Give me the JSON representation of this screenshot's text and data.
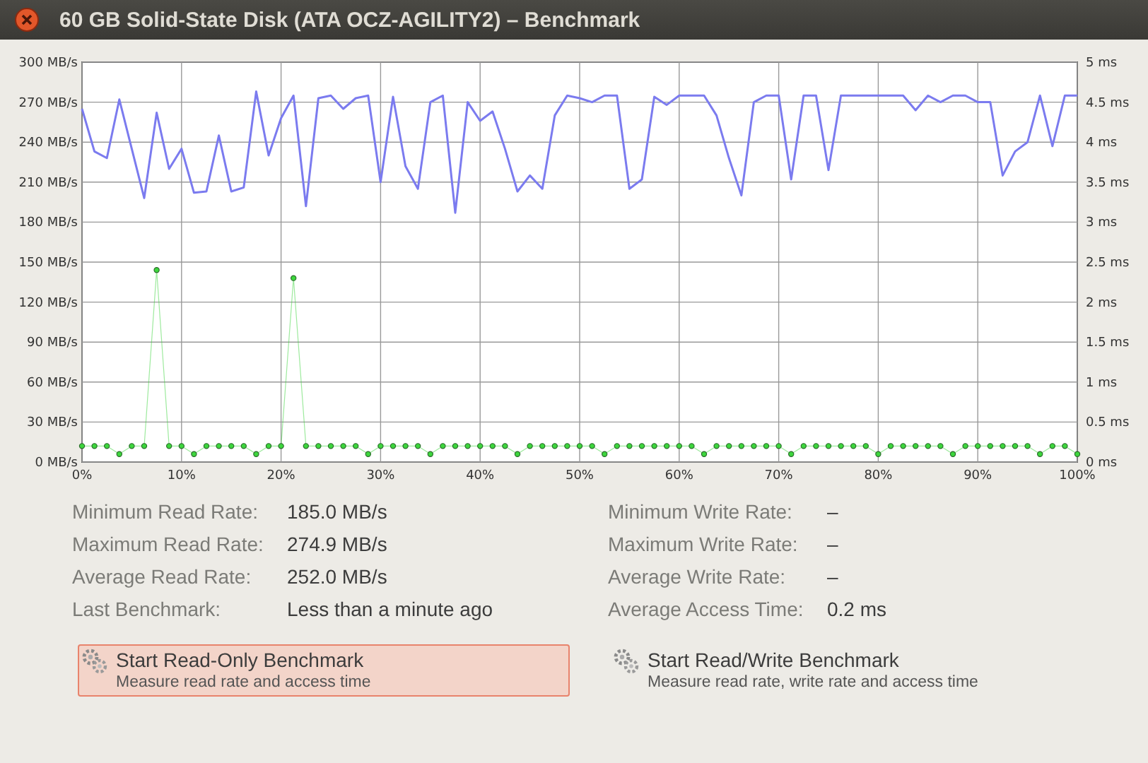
{
  "window": {
    "title": "60 GB Solid-State Disk (ATA OCZ-AGILITY2) – Benchmark"
  },
  "chart": {
    "chart_data": {
      "type": "line",
      "xlim": [
        0,
        100
      ],
      "ylim": [
        0,
        300
      ],
      "grid": true,
      "x": [
        0,
        1.25,
        2.5,
        3.75,
        5,
        6.25,
        7.5,
        8.75,
        10,
        11.25,
        12.5,
        13.75,
        15,
        16.25,
        17.5,
        18.75,
        20,
        21.25,
        22.5,
        23.75,
        25,
        26.25,
        27.5,
        28.75,
        30,
        31.25,
        32.5,
        33.75,
        35,
        36.25,
        37.5,
        38.75,
        40,
        41.25,
        42.5,
        43.75,
        45,
        46.25,
        47.5,
        48.75,
        50,
        51.25,
        52.5,
        53.75,
        55,
        56.25,
        57.5,
        58.75,
        60,
        61.25,
        62.5,
        63.75,
        65,
        66.25,
        67.5,
        68.75,
        70,
        71.25,
        72.5,
        73.75,
        75,
        76.25,
        77.5,
        78.75,
        80,
        81.25,
        82.5,
        83.75,
        85,
        86.25,
        87.5,
        88.75,
        90,
        91.25,
        92.5,
        93.75,
        95,
        96.25,
        97.5,
        98.75,
        100
      ],
      "xticks": [
        {
          "value": 0,
          "label": "0%"
        },
        {
          "value": 10,
          "label": "10%"
        },
        {
          "value": 20,
          "label": "20%"
        },
        {
          "value": 30,
          "label": "30%"
        },
        {
          "value": 40,
          "label": "40%"
        },
        {
          "value": 50,
          "label": "50%"
        },
        {
          "value": 60,
          "label": "60%"
        },
        {
          "value": 70,
          "label": "70%"
        },
        {
          "value": 80,
          "label": "80%"
        },
        {
          "value": 90,
          "label": "90%"
        },
        {
          "value": 100,
          "label": "100%"
        }
      ],
      "yticks": [
        {
          "value": 0,
          "label": "0 MB/s"
        },
        {
          "value": 30,
          "label": "30 MB/s"
        },
        {
          "value": 60,
          "label": "60 MB/s"
        },
        {
          "value": 90,
          "label": "90 MB/s"
        },
        {
          "value": 120,
          "label": "120 MB/s"
        },
        {
          "value": 150,
          "label": "150 MB/s"
        },
        {
          "value": 180,
          "label": "180 MB/s"
        },
        {
          "value": 210,
          "label": "210 MB/s"
        },
        {
          "value": 240,
          "label": "240 MB/s"
        },
        {
          "value": 270,
          "label": "270 MB/s"
        },
        {
          "value": 300,
          "label": "300 MB/s"
        }
      ],
      "y2lim": [
        0,
        5
      ],
      "y2ticks": [
        {
          "value": 0,
          "label": "0 ms"
        },
        {
          "value": 0.5,
          "label": "0.5 ms"
        },
        {
          "value": 1,
          "label": "1 ms"
        },
        {
          "value": 1.5,
          "label": "1.5 ms"
        },
        {
          "value": 2,
          "label": "2 ms"
        },
        {
          "value": 2.5,
          "label": "2.5 ms"
        },
        {
          "value": 3,
          "label": "3 ms"
        },
        {
          "value": 3.5,
          "label": "3.5 ms"
        },
        {
          "value": 4,
          "label": "4 ms"
        },
        {
          "value": 4.5,
          "label": "4.5 ms"
        },
        {
          "value": 5,
          "label": "5 ms"
        }
      ],
      "series": [
        {
          "color": "#7b7bef",
          "values": [
            265,
            233,
            228,
            272,
            235,
            198,
            262,
            220,
            235,
            202,
            203,
            245,
            203,
            206,
            278,
            230,
            258,
            275,
            192,
            273,
            275,
            265,
            273,
            275,
            210,
            274,
            222,
            205,
            270,
            275,
            187,
            270,
            256,
            263,
            235,
            203,
            215,
            205,
            260,
            275,
            273,
            270,
            275,
            275,
            205,
            212,
            274,
            268,
            275,
            275,
            275,
            260,
            228,
            200,
            270,
            275,
            275,
            212,
            275,
            275,
            219,
            275,
            275,
            275,
            275,
            275,
            275,
            264,
            275,
            270,
            275,
            275,
            270,
            270,
            215,
            233,
            240,
            275,
            237,
            275,
            275
          ]
        },
        {
          "color": "#3dd63d",
          "axis": "y2",
          "marker": "circle",
          "values": [
            0.2,
            0.2,
            0.2,
            0.1,
            0.2,
            0.2,
            2.4,
            0.2,
            0.2,
            0.1,
            0.2,
            0.2,
            0.2,
            0.2,
            0.1,
            0.2,
            0.2,
            2.3,
            0.2,
            0.2,
            0.2,
            0.2,
            0.2,
            0.1,
            0.2,
            0.2,
            0.2,
            0.2,
            0.1,
            0.2,
            0.2,
            0.2,
            0.2,
            0.2,
            0.2,
            0.1,
            0.2,
            0.2,
            0.2,
            0.2,
            0.2,
            0.2,
            0.1,
            0.2,
            0.2,
            0.2,
            0.2,
            0.2,
            0.2,
            0.2,
            0.1,
            0.2,
            0.2,
            0.2,
            0.2,
            0.2,
            0.2,
            0.1,
            0.2,
            0.2,
            0.2,
            0.2,
            0.2,
            0.2,
            0.1,
            0.2,
            0.2,
            0.2,
            0.2,
            0.2,
            0.1,
            0.2,
            0.2,
            0.2,
            0.2,
            0.2,
            0.2,
            0.1,
            0.2,
            0.2,
            0.1
          ]
        }
      ]
    }
  },
  "stats": {
    "left": [
      {
        "label": "Minimum Read Rate:",
        "value": "185.0 MB/s"
      },
      {
        "label": "Maximum Read Rate:",
        "value": "274.9 MB/s"
      },
      {
        "label": "Average Read Rate:",
        "value": "252.0 MB/s"
      },
      {
        "label": "Last Benchmark:",
        "value": "Less than a minute ago"
      }
    ],
    "right": [
      {
        "label": "Minimum Write Rate:",
        "value": "–"
      },
      {
        "label": "Maximum Write Rate:",
        "value": "–"
      },
      {
        "label": "Average Write Rate:",
        "value": "–"
      },
      {
        "label": "Average Access Time:",
        "value": "0.2 ms"
      }
    ]
  },
  "buttons": [
    {
      "title": "Start Read-Only Benchmark",
      "description": "Measure read rate and access time",
      "focused": true
    },
    {
      "title": "Start Read/Write Benchmark",
      "description": "Measure read rate, write rate and access time",
      "focused": false
    }
  ]
}
